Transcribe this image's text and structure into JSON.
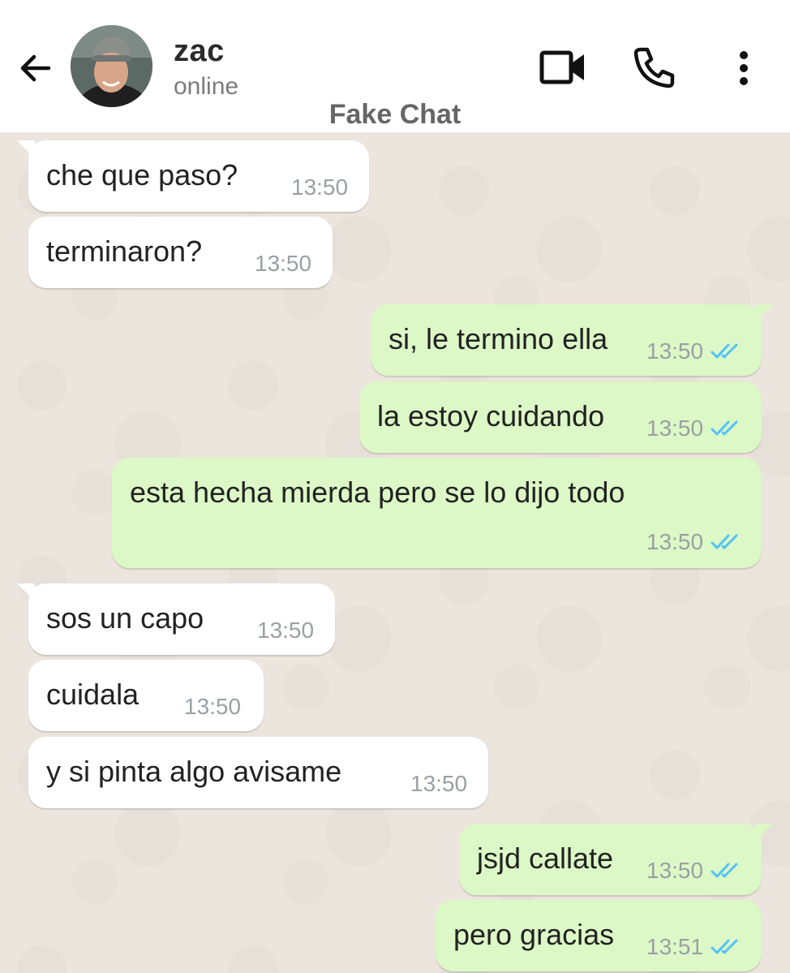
{
  "header": {
    "contact_name": "zac",
    "status": "online",
    "watermark": "Fake Chat",
    "icons": [
      "back-arrow-icon",
      "video-call-icon",
      "phone-call-icon",
      "more-options-icon"
    ],
    "accent_color": "#4fc3f7"
  },
  "messages": [
    {
      "direction": "in",
      "text": "che que paso?",
      "time": "13:50"
    },
    {
      "direction": "in",
      "text": "terminaron?",
      "time": "13:50"
    },
    {
      "direction": "out",
      "text": "si, le termino ella",
      "time": "13:50",
      "read": true
    },
    {
      "direction": "out",
      "text": "la estoy cuidando",
      "time": "13:50",
      "read": true
    },
    {
      "direction": "out",
      "text": "esta hecha mierda pero se lo dijo todo",
      "time": "13:50",
      "read": true
    },
    {
      "direction": "in",
      "text": "sos un capo",
      "time": "13:50"
    },
    {
      "direction": "in",
      "text": "cuidala",
      "time": "13:50"
    },
    {
      "direction": "in",
      "text": "y si pinta algo avisame",
      "time": "13:50"
    },
    {
      "direction": "out",
      "text": "jsjd callate",
      "time": "13:50",
      "read": true
    },
    {
      "direction": "out",
      "text": "pero gracias",
      "time": "13:51",
      "read": true
    }
  ]
}
